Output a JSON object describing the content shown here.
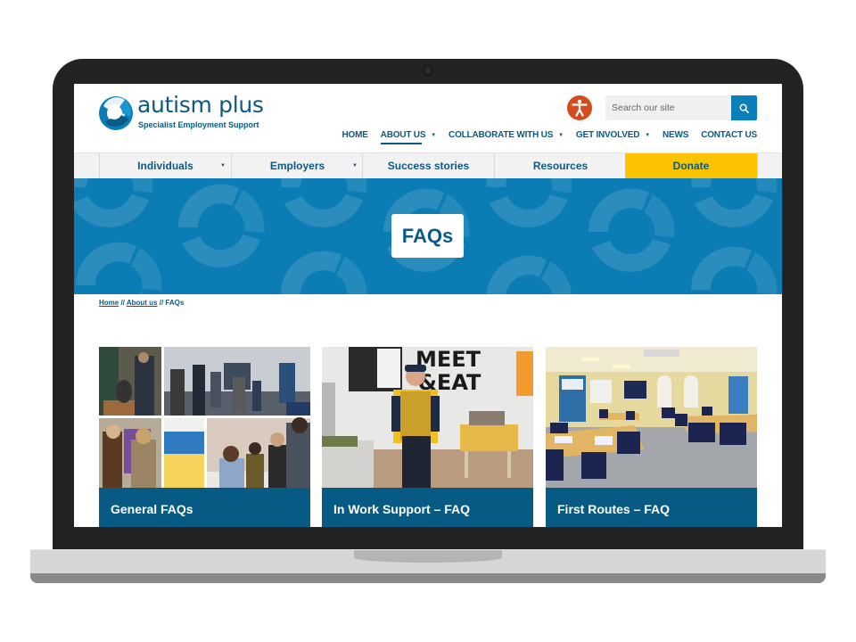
{
  "site": {
    "logo_title": "autism plus",
    "logo_subtitle": "Specialist Employment Support"
  },
  "header": {
    "accessibility_icon": "accessibility-person-icon",
    "search": {
      "placeholder": "Search our site",
      "value": "",
      "icon": "search-icon"
    },
    "top_nav": [
      {
        "label": "HOME",
        "dropdown": false,
        "active": false
      },
      {
        "label": "ABOUT US",
        "dropdown": true,
        "active": true
      },
      {
        "label": "COLLABORATE WITH US",
        "dropdown": true,
        "active": false
      },
      {
        "label": "GET INVOLVED",
        "dropdown": true,
        "active": false
      },
      {
        "label": "NEWS",
        "dropdown": false,
        "active": false
      },
      {
        "label": "CONTACT US",
        "dropdown": false,
        "active": false
      }
    ],
    "caret": "▼"
  },
  "secondary_nav": [
    {
      "label": "Individuals",
      "dropdown": true
    },
    {
      "label": "Employers",
      "dropdown": true
    },
    {
      "label": "Success stories",
      "dropdown": false
    },
    {
      "label": "Resources",
      "dropdown": false
    },
    {
      "label": "Donate",
      "dropdown": false
    }
  ],
  "hero": {
    "title": "FAQs"
  },
  "breadcrumb": {
    "items": [
      "Home",
      "About us",
      "FAQs"
    ],
    "separator": " // "
  },
  "cards": [
    {
      "label": "General FAQs",
      "image": "event-collage-photo"
    },
    {
      "label": "In Work Support – FAQ",
      "image": "meet-and-eat-employee-photo"
    },
    {
      "label": "First Routes – FAQ",
      "image": "training-room-photo"
    }
  ],
  "colors": {
    "brand_blue": "#0a5a85",
    "hero_blue": "#0b7db4",
    "donate_yellow": "#fcc400",
    "accessibility_orange": "#d44c1d",
    "card_label_blue": "#075a83"
  }
}
